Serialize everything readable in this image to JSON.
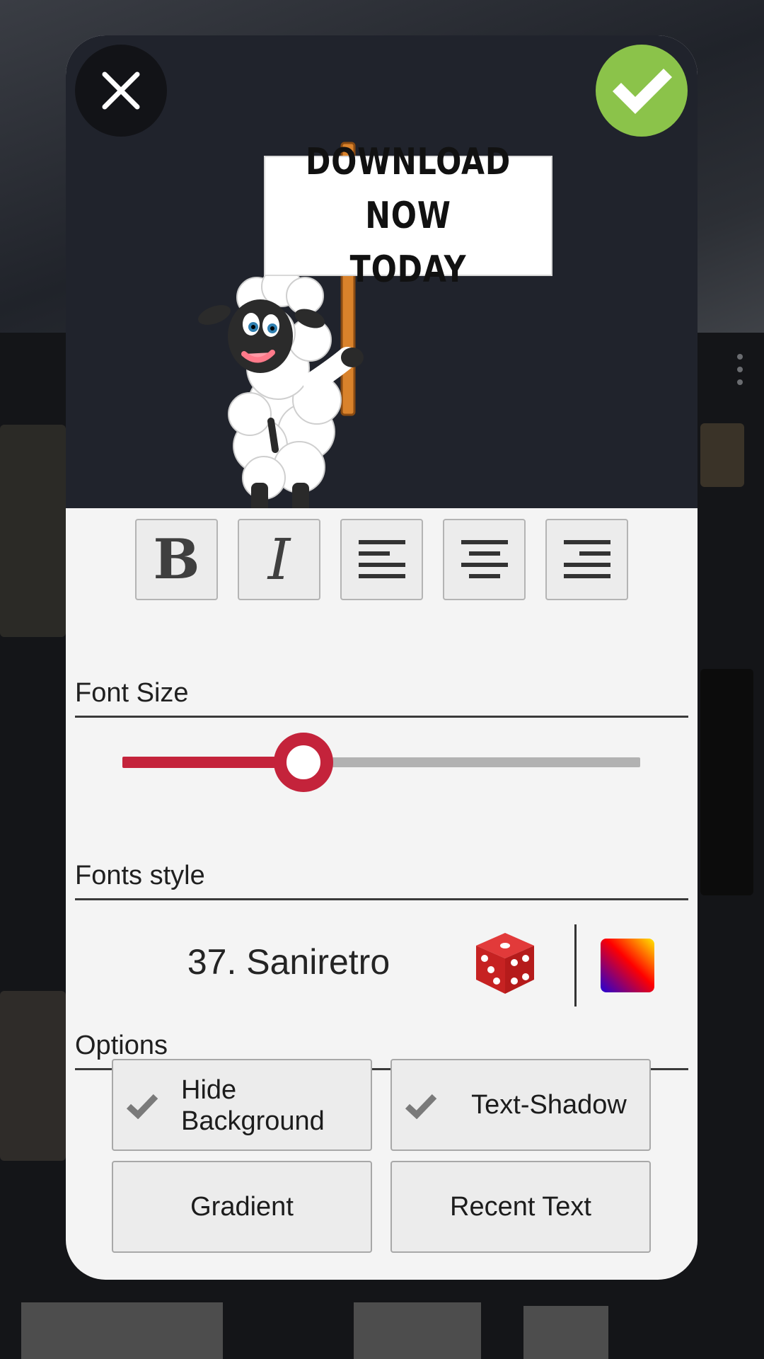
{
  "preview": {
    "sign_text": "DOWNLOAD NOW\nTODAY",
    "close_icon": "close-icon",
    "confirm_icon": "check-icon"
  },
  "format": {
    "bold_label": "B",
    "italic_label": "I",
    "align_left_icon": "align-left-icon",
    "align_center_icon": "align-center-icon",
    "align_right_icon": "align-right-icon"
  },
  "font_size": {
    "label": "Font Size",
    "value_fraction": 0.32
  },
  "fonts_style": {
    "label": "Fonts style",
    "current_font": "37. Saniretro",
    "random_icon": "dice-icon",
    "color_icon": "gradient-swatch"
  },
  "options": {
    "label": "Options",
    "hide_background": "Hide\nBackground",
    "text_shadow": "Text-Shadow",
    "gradient": "Gradient",
    "recent_text": "Recent Text"
  },
  "colors": {
    "accent_red": "#c4233b",
    "confirm_green": "#8bc34a",
    "preview_bg": "#20232c",
    "panel_bg": "#f4f4f4"
  }
}
